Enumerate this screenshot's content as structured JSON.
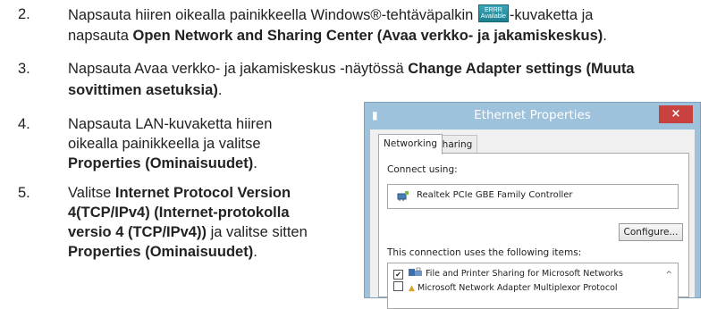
{
  "steps": [
    {
      "number": "2.",
      "line1_a": "Napsauta hiiren oikealla painikkeella Windows®-tehtäväpalkin ",
      "line1_b": "-kuvaketta ja",
      "line2_a": "napsauta ",
      "line2_bold": "Open Network and Sharing Center (Avaa verkko- ja jakamiskeskus)",
      "line2_end": "."
    },
    {
      "number": "3.",
      "line1_a": "Napsauta Avaa verkko- ja jakamiskeskus -näytössä ",
      "line1_bold": "Change Adapter settings (Muuta",
      "line2_bold": "sovittimen asetuksia)",
      "line2_end": "."
    },
    {
      "number": "4.",
      "line1": "Napsauta LAN-kuvaketta hiiren",
      "line2": "oikealla painikkeella ja valitse",
      "line3_bold": "Properties (Ominaisuudet)",
      "line3_end": "."
    },
    {
      "number": "5.",
      "line1_a": "Valitse ",
      "line1_bold": "Internet Protocol Version",
      "line2_bold": "4(TCP/IPv4) (Internet-protokolla",
      "line3_bold": "versio 4 (TCP/IPv4))",
      "line3_end": " ja valitse sitten",
      "line4_bold": "Properties (Ominaisuudet)",
      "line4_end": "."
    }
  ],
  "taskbar_icon": {
    "top_text": "ERRR",
    "bottom_text": "Available",
    "color": "#2a93a6"
  },
  "dialog": {
    "title": "Ethernet Properties",
    "close_symbol": "×",
    "tabs": [
      "Networking",
      "Sharing"
    ],
    "connect_using_label": "Connect using:",
    "adapter_name": "Realtek PCIe GBE Family Controller",
    "configure_label": "Configure...",
    "items_label": "This connection uses the following items:",
    "items": [
      {
        "label": "File and Printer Sharing for Microsoft Networks",
        "checked": "✔"
      },
      {
        "label": "Microsoft Network Adapter Multiplexor Protocol",
        "checked": ""
      }
    ],
    "title_bar_color": "#9ec1dc",
    "close_color": "#c8413f"
  }
}
